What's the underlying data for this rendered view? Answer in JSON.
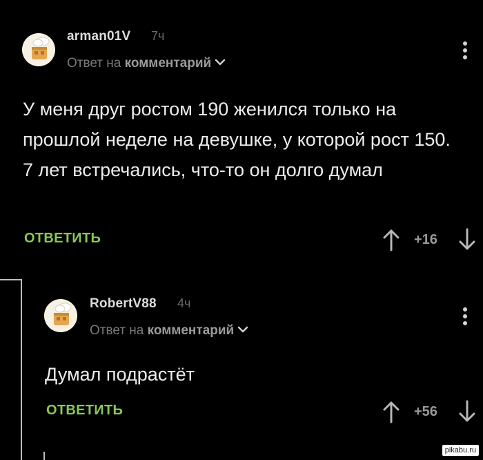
{
  "comments": [
    {
      "username": "arman01V",
      "time": "7ч",
      "reply_prefix": "Ответ на",
      "reply_target": "комментарий",
      "text": "У меня друг ростом 190 женился только на прошлой неделе на девушке, у которой рост 150. 7 лет встречались, что-то он долго думал",
      "reply_label": "ОТВЕТИТЬ",
      "score": "+16",
      "avatar_icon": "cook-hat-house-avatar-icon"
    },
    {
      "username": "RobertV88",
      "time": "4ч",
      "reply_prefix": "Ответ на",
      "reply_target": "комментарий",
      "text": "Думал подрастёт",
      "reply_label": "ОТВЕТИТЬ",
      "score": "+56",
      "avatar_icon": "cook-hat-house-avatar-icon"
    }
  ],
  "watermark": "pikabu.ru",
  "colors": {
    "background": "#000000",
    "reply_green": "#8ac858",
    "muted": "#7a7a7a"
  }
}
